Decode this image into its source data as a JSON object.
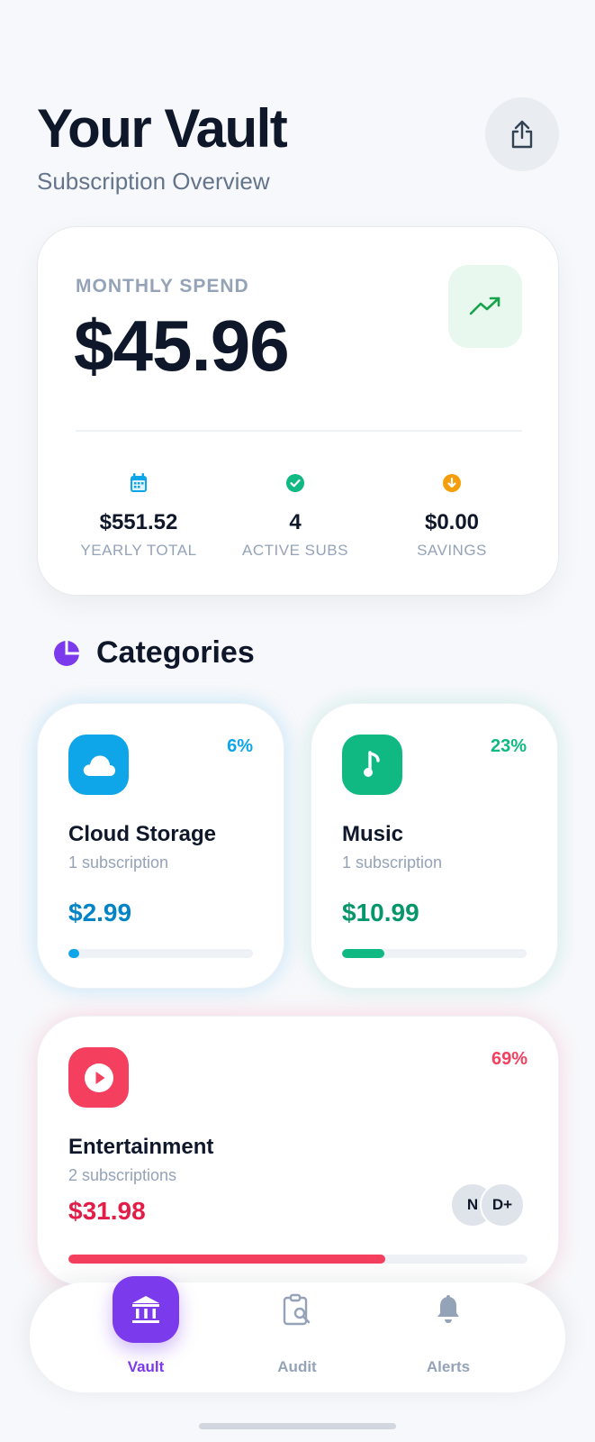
{
  "header": {
    "title": "Your Vault",
    "subtitle": "Subscription Overview",
    "share_icon": "share-icon"
  },
  "summary": {
    "label": "MONTHLY SPEND",
    "amount": "$45.96",
    "trend_icon": "trending-up-icon",
    "stats": [
      {
        "icon": "calendar-icon",
        "value": "$551.52",
        "label": "YEARLY TOTAL",
        "color": "#0ea5e9"
      },
      {
        "icon": "check-circle-icon",
        "value": "4",
        "label": "ACTIVE SUBS",
        "color": "#10b981"
      },
      {
        "icon": "arrow-down-circle-icon",
        "value": "$0.00",
        "label": "SAVINGS",
        "color": "#f59e0b"
      }
    ]
  },
  "categories": {
    "title": "Categories",
    "icon": "pie-chart-icon",
    "items": [
      {
        "name": "Cloud Storage",
        "count": "1 subscription",
        "price": "$2.99",
        "percent": "6%",
        "share": 0.06,
        "color": "#0ea5e9",
        "text_color": "#0284c7",
        "icon": "cloud-icon"
      },
      {
        "name": "Music",
        "count": "1 subscription",
        "price": "$10.99",
        "percent": "23%",
        "share": 0.23,
        "color": "#10b981",
        "text_color": "#059669",
        "icon": "music-note-icon"
      },
      {
        "name": "Entertainment",
        "count": "2 subscriptions",
        "price": "$31.98",
        "percent": "69%",
        "share": 0.69,
        "color": "#f43f5e",
        "text_color": "#e11d48",
        "icon": "play-icon",
        "avatars": [
          "N",
          "D+"
        ]
      }
    ]
  },
  "nav": {
    "items": [
      {
        "label": "Vault",
        "icon": "bank-icon",
        "active": true
      },
      {
        "label": "Audit",
        "icon": "clipboard-search-icon",
        "active": false
      },
      {
        "label": "Alerts",
        "icon": "bell-icon",
        "active": false
      }
    ],
    "active_color": "#7c3aed",
    "inactive_color": "#94a3b8"
  }
}
